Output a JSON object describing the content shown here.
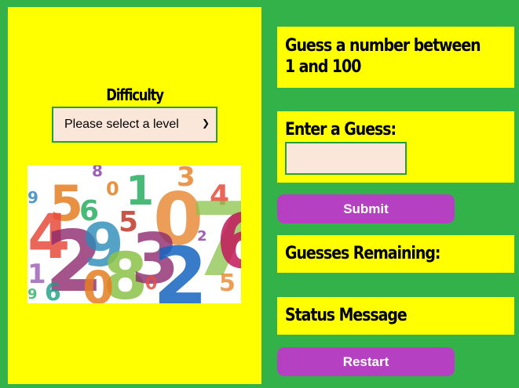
{
  "difficulty": {
    "label": "Difficulty",
    "select_value": "Please select a level"
  },
  "image": {
    "icon": "colorful-numbers-image"
  },
  "prompt": {
    "text": "Guess a number between 1 and 100"
  },
  "guess": {
    "label": "Enter a Guess:",
    "value": ""
  },
  "buttons": {
    "submit": "Submit",
    "restart": "Restart"
  },
  "remaining": {
    "label": "Guesses Remaining:"
  },
  "status": {
    "label": "Status Message"
  },
  "colors": {
    "background": "#33b249",
    "panel": "#ffff00",
    "button": "#b541c2",
    "input": "#fbe6da"
  }
}
